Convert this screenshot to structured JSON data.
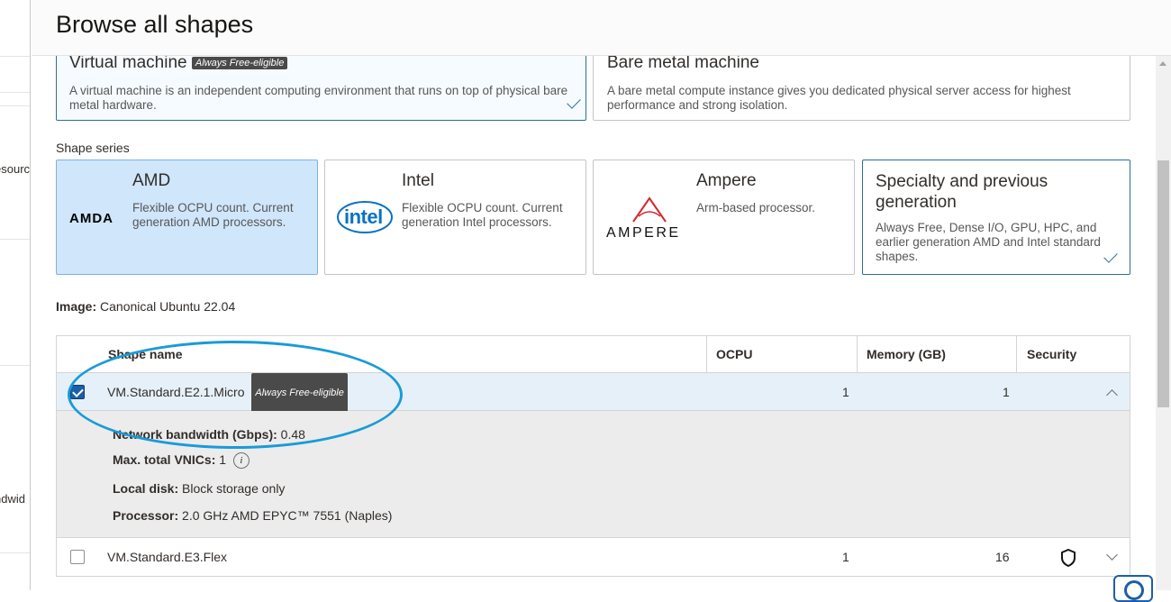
{
  "background": {
    "fragments": [
      "esourc",
      "ndwid"
    ]
  },
  "panel": {
    "title": "Browse all shapes"
  },
  "instance_types": [
    {
      "title": "Virtual machine",
      "badge": "Always Free-eligible",
      "description": "A virtual machine is an independent computing environment that runs on top of physical bare metal hardware.",
      "selected": true
    },
    {
      "title": "Bare metal machine",
      "description": "A bare metal compute instance gives you dedicated physical server access for highest performance and strong isolation.",
      "selected": false
    }
  ],
  "shape_series": {
    "label": "Shape series",
    "cards": [
      {
        "title": "AMD",
        "logo": "AMDA",
        "description": "Flexible OCPU count. Current generation AMD processors."
      },
      {
        "title": "Intel",
        "logo": "intel",
        "description": "Flexible OCPU count. Current generation Intel processors."
      },
      {
        "title": "Ampere",
        "logo": "AMPERE",
        "description": "Arm-based processor."
      },
      {
        "title": "Specialty and previous generation",
        "description": "Always Free, Dense I/O, GPU, HPC, and earlier generation AMD and Intel standard shapes.",
        "selected": true
      }
    ]
  },
  "image": {
    "label": "Image:",
    "value": "Canonical Ubuntu 22.04"
  },
  "table": {
    "headers": [
      "Shape name",
      "OCPU",
      "Memory (GB)",
      "Security"
    ],
    "rows": [
      {
        "name": "VM.Standard.E2.1.Micro",
        "badge": "Always Free-eligible",
        "ocpu": "1",
        "memory": "1",
        "checked": true,
        "expanded": true
      },
      {
        "name": "VM.Standard.E3.Flex",
        "ocpu": "1",
        "memory": "16",
        "checked": false,
        "expanded": false,
        "security_icon": "shield-icon"
      }
    ],
    "details": [
      {
        "label": "Network bandwidth (Gbps):",
        "value": "0.48"
      },
      {
        "label": "Max. total VNICs:",
        "value": "1",
        "info": "i"
      },
      {
        "label": "Local disk:",
        "value": "Block storage only"
      },
      {
        "label": "Processor:",
        "value": "2.0 GHz AMD EPYC™ 7551 (Naples)"
      }
    ]
  },
  "colors": {
    "accent": "#2a6f97",
    "selected_card": "#cfe6fb",
    "annotation": "#1a9bd7",
    "checkbox": "#1b5fa8"
  }
}
